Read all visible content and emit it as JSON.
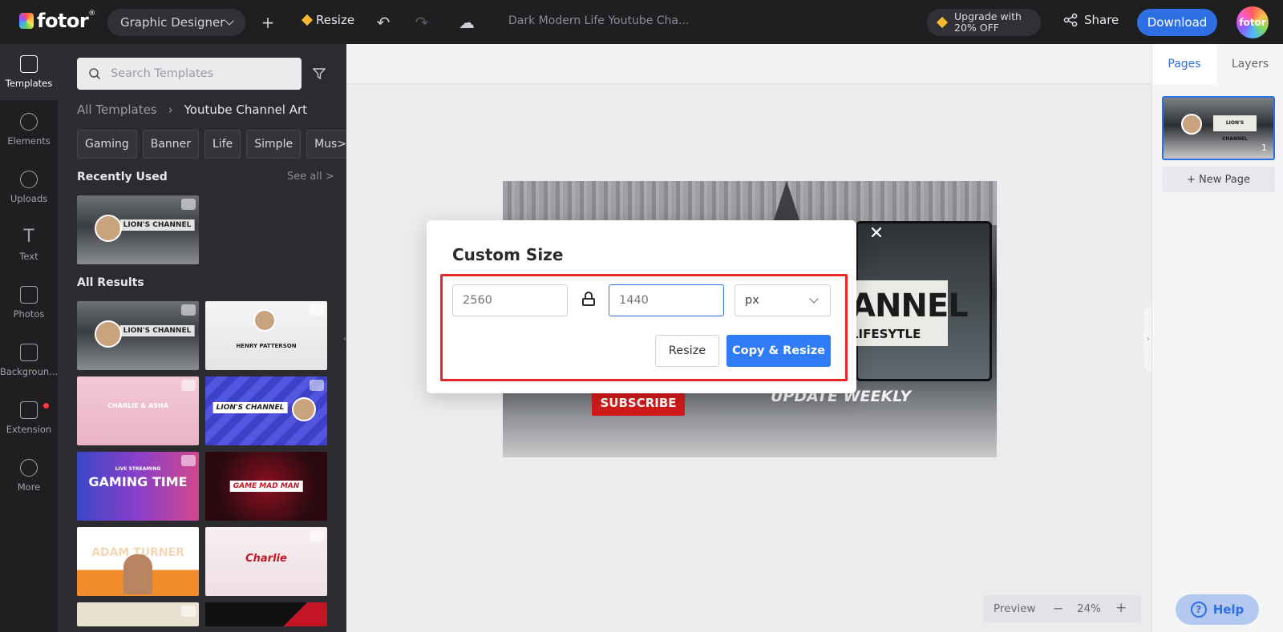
{
  "topbar": {
    "logo": "fotor",
    "role": "Graphic Designer",
    "resize_label": "Resize",
    "doc_title": "Dark Modern Life Youtube Cha...",
    "upgrade_line1": "Upgrade with",
    "upgrade_line2": "20% OFF",
    "share_label": "Share",
    "download_label": "Download",
    "avatar_label": "fotor"
  },
  "rail": [
    {
      "label": "Templates",
      "icon": "templates-icon"
    },
    {
      "label": "Elements",
      "icon": "elements-icon"
    },
    {
      "label": "Uploads",
      "icon": "upload-icon"
    },
    {
      "label": "Text",
      "icon": "text-icon"
    },
    {
      "label": "Photos",
      "icon": "photo-icon"
    },
    {
      "label": "Backgroun...",
      "icon": "background-icon"
    },
    {
      "label": "Extension",
      "icon": "extension-icon"
    },
    {
      "label": "More",
      "icon": "more-icon"
    }
  ],
  "templates": {
    "search_placeholder": "Search Templates",
    "breadcrumb_root": "All Templates",
    "breadcrumb_current": "Youtube Channel Art",
    "chips": [
      "Gaming",
      "Banner",
      "Life",
      "Simple",
      "Mus>"
    ],
    "recently_used": "Recently Used",
    "see_all": "See all >",
    "all_results": "All Results",
    "thumb_texts": {
      "lions_channel": "LION'S CHANNEL",
      "henry": "HENRY PATTERSON",
      "charlie": "CHARLIE & ASHA",
      "gaming_small": "LIVE STREAMING",
      "gaming_big": "GAMING TIME",
      "game_mad": "GAME MAD MAN",
      "adam": "ADAM TURNER",
      "charlie_script": "Charlie"
    }
  },
  "canvas": {
    "title_text": "ANNEL",
    "subtitle_text": "LIFESYTLE",
    "subscribe_text": "SUBSCRIBE",
    "update_text": "UPDATE WEEKLY",
    "thumb_card_text": "LION'S CHANNEL"
  },
  "zoom": {
    "preview": "Preview",
    "minus": "−",
    "value": "24%",
    "plus": "+"
  },
  "right_panel": {
    "tab_pages": "Pages",
    "tab_layers": "Layers",
    "page_number": "1",
    "new_page": "+ New Page",
    "help": "Help"
  },
  "modal": {
    "title": "Custom Size",
    "width_placeholder": "2560",
    "height_placeholder": "1440",
    "unit": "px",
    "resize_label": "Resize",
    "copy_resize_label": "Copy & Resize",
    "close": "✕"
  }
}
